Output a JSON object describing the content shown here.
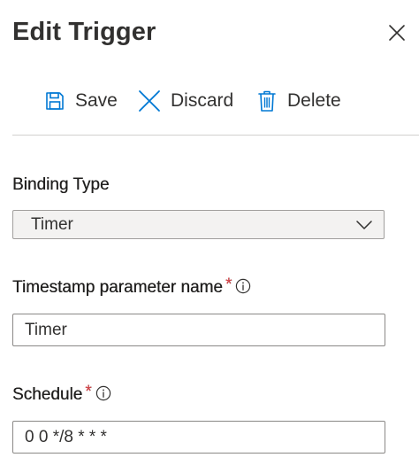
{
  "panel": {
    "title": "Edit Trigger"
  },
  "toolbar": {
    "save_label": "Save",
    "discard_label": "Discard",
    "delete_label": "Delete"
  },
  "fields": {
    "binding_type": {
      "label": "Binding Type",
      "value": "Timer"
    },
    "timestamp_parameter_name": {
      "label": "Timestamp parameter name",
      "required_marker": "*",
      "value": "Timer"
    },
    "schedule": {
      "label": "Schedule",
      "required_marker": "*",
      "value": "0 0 */8 * * *"
    }
  },
  "icons": {
    "close": "close-icon",
    "save": "save-icon",
    "discard": "discard-icon",
    "delete": "trash-icon",
    "info": "info-icon",
    "dropdown": "chevron-down-icon"
  },
  "colors": {
    "accent": "#0078d4",
    "required": "#e0454a",
    "text": "#323130",
    "divider": "#d2d0ce"
  }
}
